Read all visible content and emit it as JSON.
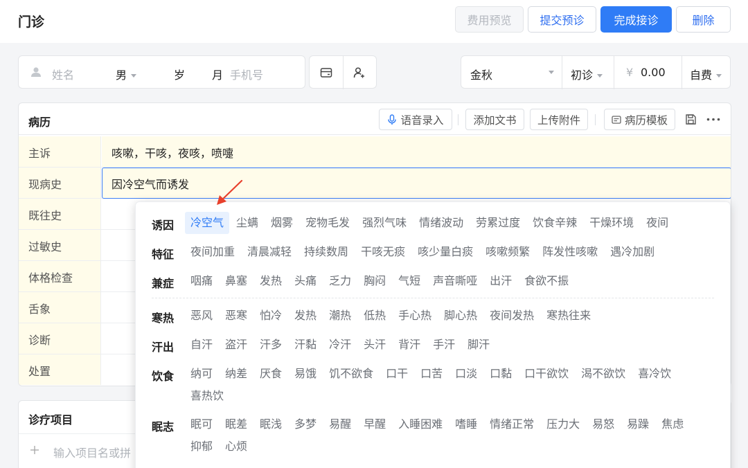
{
  "header": {
    "title": "门诊",
    "buttons": {
      "fee_preview": "费用预览",
      "submit_prediag": "提交预诊",
      "complete": "完成接诊",
      "delete": "删除"
    }
  },
  "patient": {
    "name_placeholder": "姓名",
    "gender": "男",
    "age_unit_year": "岁",
    "age_unit_month": "月",
    "phone_placeholder": "手机号",
    "doctor": "金秋",
    "visit_type": "初诊",
    "currency": "¥",
    "fee": "0.00",
    "payment": "自费"
  },
  "record": {
    "title": "病历",
    "tools": {
      "voice": "语音录入",
      "add_doc": "添加文书",
      "upload": "上传附件",
      "template": "病历模板"
    },
    "rows": [
      {
        "label": "主诉",
        "value": "咳嗽，干咳，夜咳，喷嚏"
      },
      {
        "label": "现病史",
        "value": "因冷空气而诱发"
      },
      {
        "label": "既往史",
        "value": ""
      },
      {
        "label": "过敏史",
        "value": ""
      },
      {
        "label": "体格检查",
        "value": ""
      },
      {
        "label": "舌象",
        "value": ""
      },
      {
        "label": "诊断",
        "value": ""
      },
      {
        "label": "处置",
        "value": ""
      }
    ]
  },
  "treatment": {
    "title": "诊疗项目",
    "input_placeholder": "输入项目名或拼"
  },
  "suggestions": {
    "groups": [
      {
        "category": "诱因",
        "tags": [
          "冷空气",
          "尘螨",
          "烟雾",
          "宠物毛发",
          "强烈气味",
          "情绪波动",
          "劳累过度",
          "饮食辛辣",
          "干燥环境",
          "夜间"
        ]
      },
      {
        "category": "特征",
        "tags": [
          "夜间加重",
          "清晨减轻",
          "持续数周",
          "干咳无痰",
          "咳少量白痰",
          "咳嗽频繁",
          "阵发性咳嗽",
          "遇冷加剧"
        ]
      },
      {
        "category": "兼症",
        "tags": [
          "咽痛",
          "鼻塞",
          "发热",
          "头痛",
          "乏力",
          "胸闷",
          "气短",
          "声音嘶哑",
          "出汗",
          "食欲不振"
        ]
      },
      {
        "category": "寒热",
        "tags": [
          "恶风",
          "恶寒",
          "怕冷",
          "发热",
          "潮热",
          "低热",
          "手心热",
          "脚心热",
          "夜间发热",
          "寒热往来"
        ]
      },
      {
        "category": "汗出",
        "tags": [
          "自汗",
          "盗汗",
          "汗多",
          "汗黏",
          "冷汗",
          "头汗",
          "背汗",
          "手汗",
          "脚汗"
        ]
      },
      {
        "category": "饮食",
        "tags": [
          "纳可",
          "纳差",
          "厌食",
          "易饿",
          "饥不欲食",
          "口干",
          "口苦",
          "口淡",
          "口黏",
          "口干欲饮",
          "渴不欲饮",
          "喜冷饮",
          "喜热饮"
        ]
      },
      {
        "category": "眠志",
        "tags": [
          "眠可",
          "眠差",
          "眠浅",
          "多梦",
          "易醒",
          "早醒",
          "入睡困难",
          "嗜睡",
          "情绪正常",
          "压力大",
          "易怒",
          "易躁",
          "焦虑",
          "抑郁",
          "心烦"
        ]
      }
    ],
    "selected": "冷空气"
  },
  "colors": {
    "primary": "#2f7cf6",
    "highlight_bg": "#fffcea",
    "tag_selected_bg": "#e8f1fe",
    "arrow": "#e8402c"
  }
}
